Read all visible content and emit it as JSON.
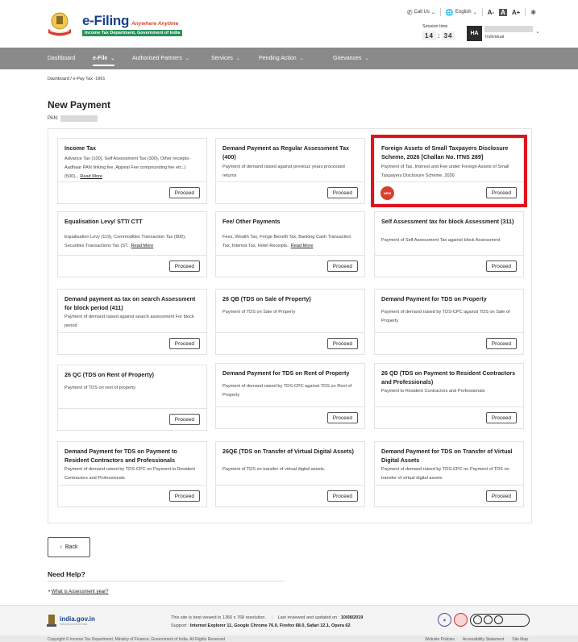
{
  "header": {
    "logo_title": "e-Filing",
    "logo_tagline": "Anywhere Anytime",
    "logo_subtitle": "Income Tax Department, Government of India",
    "call_us": "Call Us",
    "language": "English",
    "font_decrease": "A-",
    "font_normal": "A",
    "font_increase": "A+",
    "session_label": "Session time",
    "session_minutes": "14",
    "session_seconds": "34",
    "user_initials": "HA",
    "user_role": "Individual"
  },
  "nav": {
    "items": [
      {
        "label": "Dashboard"
      },
      {
        "label": "e-File"
      },
      {
        "label": "Authorised Partners"
      },
      {
        "label": "Services"
      },
      {
        "label": "Pending Action"
      },
      {
        "label": "Grievances"
      }
    ]
  },
  "breadcrumb": "Dashboard  / e-Pay Tax -1961",
  "page_title": "New Payment",
  "pan_label": "PAN:",
  "cards": [
    {
      "title": "Income Tax",
      "desc": "Advance Tax (100), Self Assessment Tax (300),  Other receipts-Aadhaar PAN linking fee, Appeal Fee compounding fee etc..) (500),..",
      "read_more": "Read More",
      "button": "Proceed"
    },
    {
      "title": "Demand Payment as Regular Assessment Tax (400)",
      "desc": "Payment of demand raised against previous years processed returns",
      "button": "Proceed"
    },
    {
      "title": "Foreign Assets of Small Taxpayers Disclosure Scheme, 2026 [Challan No. ITNS 289]",
      "desc": "Payment of Tax, Interest and Fee under Foreign Assets of Small Taxpayers Disclosure Scheme, 2026",
      "button": "Proceed",
      "badge": "NEW"
    },
    {
      "title": "Equalisation Levy/ STT/ CTT",
      "desc": "Equalisation Levy (119), Commodities Transaction Tax (800), Securities Transactions Tax (ST..",
      "read_more": "Read More",
      "button": "Proceed"
    },
    {
      "title": "Fee/ Other Payments",
      "desc": "Fees, Wealth Tax, Fringe Benefit Tax, Banking Cash Transaction Tax, Interest Tax, Hotel Receipts..",
      "read_more": "Read More",
      "button": "Proceed"
    },
    {
      "title": "Self Assessment tax for block Assessment (311)",
      "desc": "Payment of Self Assessment Tax against block Assessment",
      "button": "Proceed"
    },
    {
      "title": "Demand payment as tax on search Assessment for block period (411)",
      "desc": "Payment of demand raised against search assessment For block period",
      "button": "Proceed"
    },
    {
      "title": "26 QB (TDS on Sale of Property)",
      "desc": "Payment of TDS on Sale of Property",
      "button": "Proceed"
    },
    {
      "title": "Demand Payment for TDS on Property",
      "desc": "Payment of demand raised by TDS-CPC against TDS on Sale of Property",
      "button": "Proceed"
    },
    {
      "title": "26 QC (TDS on Rent of Property)",
      "desc": "Payment of TDS on rent of property",
      "button": "Proceed"
    },
    {
      "title": "Demand Payment for TDS on Rent of Property",
      "desc": "Payment of demand raised by TDS-CPC against TDS on Rent of Property",
      "button": "Proceed"
    },
    {
      "title": "26 QD (TDS on Payment to Resident Contractors and Professionals)",
      "desc": "Payment to Resident Contractors and Professionals",
      "button": "Proceed"
    },
    {
      "title": "Demand Payment for TDS on Payment to Resident Contractors and Professionals",
      "desc": "Payment of demand raised by TDS-CPC on Payment to Resident Contractors and Professionals",
      "button": "Proceed"
    },
    {
      "title": "26QE (TDS on Transfer of Virtual Digital Assets)",
      "desc": "Payment of TDS on transfer of virtual digital assets.",
      "button": "Proceed"
    },
    {
      "title": "Demand Payment for TDS on Transfer of Virtual Digital Assets",
      "desc": "Payment of demand raised by TDS-CPC on Payment of TDS on transfer of virtual digital assets",
      "button": "Proceed"
    }
  ],
  "back_button": "Back",
  "help": {
    "title": "Need Help?",
    "link": "What is Assessment year?"
  },
  "footer": {
    "india_logo": "india.gov.in",
    "india_sub": "national portal of india",
    "best_viewed": "This site is best viewed in 1366 x 768 resolution.",
    "last_reviewed_label": "Last reviewed and updated on :",
    "last_reviewed_date": "10/08/2019",
    "support_label": "Support :",
    "support_browsers": "Internet Explorer 11, Google Chrome 76.0,  Firefox 68.0, Safari 12.1, Opera 62",
    "copyright": "Copyright © Income Tax Department, Ministry of Finance, Government of India. All Rights Reserved",
    "links": [
      "Website Policies",
      "Accessibility Statement",
      "Site Map"
    ]
  },
  "colors": {
    "nav_bg": "#8a8a8a",
    "highlight": "#e0131b",
    "brand_blue": "#1b3f8b",
    "new_badge": "#d8402e"
  }
}
